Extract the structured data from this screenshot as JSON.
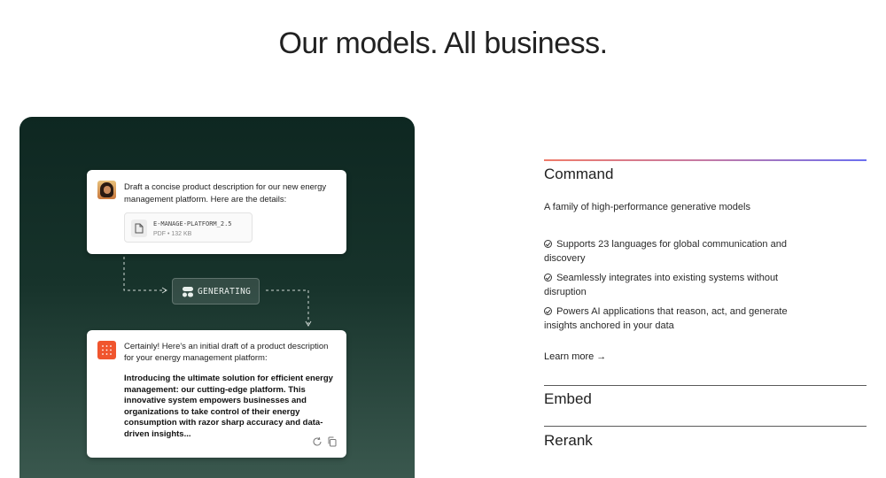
{
  "page": {
    "title": "Our models. All business."
  },
  "demo": {
    "prompt_text": "Draft a concise product description for our new energy management platform. Here are the details:",
    "file": {
      "name": "E-MANAGE-PLATFORM_2.5",
      "meta": "PDF • 132 KB",
      "icon": "document-icon"
    },
    "generating_label": "GENERATING",
    "response_intro": "Certainly! Here's an initial draft of a product description for your energy management platform:",
    "response_body": "Introducing the ultimate solution for efficient energy management: our cutting-edge platform. This innovative system empowers businesses and organizations to take control of their energy consumption with razor sharp accuracy and data-driven insights...",
    "actions": [
      "refresh-icon",
      "copy-icon"
    ]
  },
  "models": {
    "command": {
      "title": "Command",
      "subtitle": "A family of high-performance generative models",
      "features": [
        "Supports 23 languages for global communication and discovery",
        "Seamlessly integrates into existing systems without disruption",
        "Powers AI applications that reason, act, and generate insights anchored in your data"
      ],
      "learn_more": "Learn more →"
    },
    "embed": {
      "title": "Embed"
    },
    "rerank": {
      "title": "Rerank"
    }
  },
  "colors": {
    "panel_dark": "#0e2721",
    "accent_start": "#ef7b6a",
    "accent_end": "#6b6ff0",
    "bot_avatar": "#f0552e"
  }
}
